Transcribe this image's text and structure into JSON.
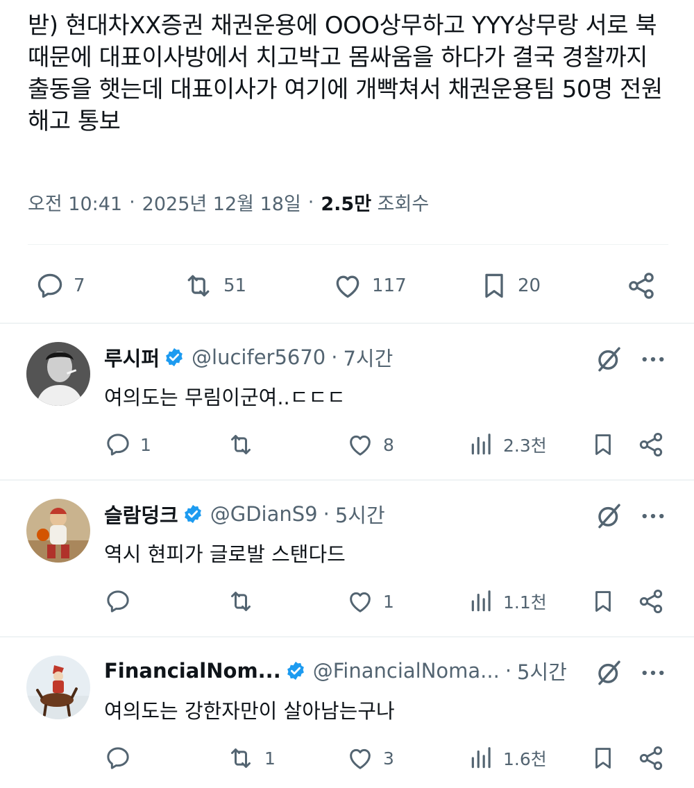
{
  "tweet": {
    "text": "받) 현대차XX증권 채권운용에 OOO상무하고 YYY상무랑 서로 북 때문에 대표이사방에서 치고박고 몸싸움을 하다가 결국 경찰까지 출동을 햇는데 대표이사가 여기에 개빡쳐서 채권운용팀 50명 전원 해고 통보",
    "time": "오전 10:41",
    "date": "2025년 12월 18일",
    "views_count": "2.5만",
    "views_label": "조회수",
    "separator": "·",
    "replies": "7",
    "reposts": "51",
    "likes": "117",
    "bookmarks": "20"
  },
  "replies": [
    {
      "name": "루시퍼",
      "handle": "@lucifer5670",
      "time": "7시간",
      "text": "여의도는 무림이군여..ㄷㄷㄷ",
      "reply_count": "1",
      "repost_count": "",
      "like_count": "8",
      "view_count": "2.3천"
    },
    {
      "name": "슬람덩크",
      "handle": "@GDianS9",
      "time": "5시간",
      "text": "역시 현피가 글로발 스탠다드",
      "reply_count": "",
      "repost_count": "",
      "like_count": "1",
      "view_count": "1.1천"
    },
    {
      "name": "FinancialNom...",
      "handle": "@FinancialNoma...",
      "time": "5시간",
      "text": "여의도는 강한자만이 살아남는구나",
      "reply_count": "",
      "repost_count": "1",
      "like_count": "3",
      "view_count": "1.6천"
    }
  ],
  "icons": {
    "reply": "speech-bubble-icon",
    "repost": "repost-arrows-icon",
    "like": "heart-icon",
    "bookmark": "bookmark-icon",
    "share": "share-icon",
    "views": "bar-chart-icon",
    "verified": "verified-badge-icon",
    "grok": "grok-icon",
    "more": "more-dots-icon"
  },
  "colors": {
    "text": "#0f1419",
    "muted": "#536471",
    "verified": "#1d9bf0",
    "divider": "#eff3f4"
  }
}
